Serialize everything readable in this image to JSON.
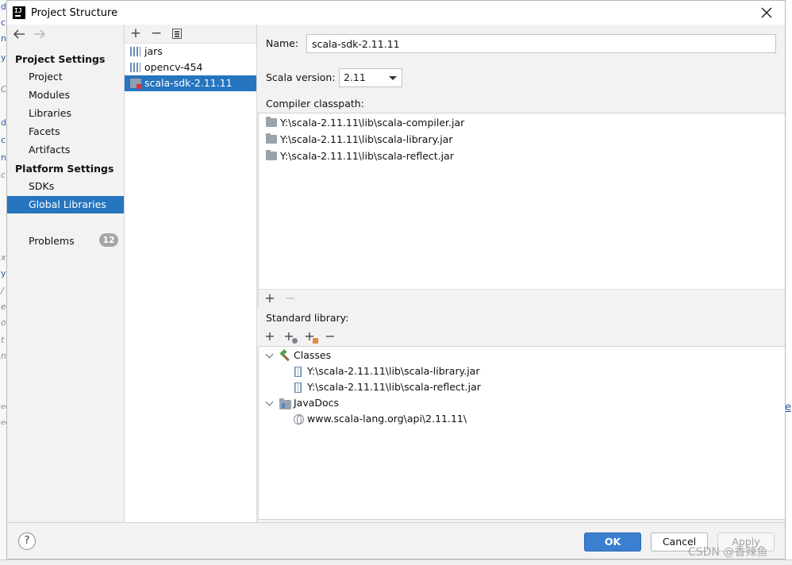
{
  "window": {
    "title": "Project Structure"
  },
  "background": {
    "left_glyphs": [
      "d",
      "c",
      "n",
      "y",
      "C",
      "d",
      "c",
      "n",
      "c",
      "x",
      "y",
      "/",
      "e",
      "o",
      "t",
      "n",
      "ec",
      "ec"
    ],
    "right_link": "e"
  },
  "nav": {
    "back_icon": "arrow-left",
    "forward_icon": "arrow-right",
    "project_settings_header": "Project Settings",
    "project_settings_items": [
      "Project",
      "Modules",
      "Libraries",
      "Facets",
      "Artifacts"
    ],
    "platform_settings_header": "Platform Settings",
    "platform_settings_items": [
      "SDKs",
      "Global Libraries"
    ],
    "selected": "Global Libraries",
    "problems_label": "Problems",
    "problems_count": "12"
  },
  "library_list": {
    "toolbar": {
      "add": "+",
      "remove": "−",
      "copy_icon": "copy-icon"
    },
    "items": [
      "jars",
      "opencv-454",
      "scala-sdk-2.11.11"
    ],
    "selected": "scala-sdk-2.11.11"
  },
  "detail": {
    "name_label": "Name:",
    "name_value": "scala-sdk-2.11.11",
    "scala_version_label": "Scala version:",
    "scala_version_value": "2.11",
    "compiler_classpath_label": "Compiler classpath:",
    "classpath": [
      "Y:\\scala-2.11.11\\lib\\scala-compiler.jar",
      "Y:\\scala-2.11.11\\lib\\scala-library.jar",
      "Y:\\scala-2.11.11\\lib\\scala-reflect.jar"
    ],
    "classpath_toolbar": {
      "add": "+",
      "remove": "−"
    },
    "standard_library_label": "Standard library:",
    "standard_library_toolbar": {
      "add": "+",
      "add_doc": "+",
      "add_ext": "+",
      "remove": "−"
    },
    "tree": {
      "classes_label": "Classes",
      "classes": [
        "Y:\\scala-2.11.11\\lib\\scala-library.jar",
        "Y:\\scala-2.11.11\\lib\\scala-reflect.jar"
      ],
      "javadocs_label": "JavaDocs",
      "javadocs": [
        "www.scala-lang.org\\api\\2.11.11\\"
      ]
    }
  },
  "footer": {
    "help_label": "?",
    "ok_label": "OK",
    "cancel_label": "Cancel",
    "apply_label": "Apply"
  },
  "watermark": "CSDN @香辣鱼",
  "colors": {
    "selection": "#2675bf",
    "ok_button": "#3b7fd0",
    "badge": "#a5a5a5"
  }
}
